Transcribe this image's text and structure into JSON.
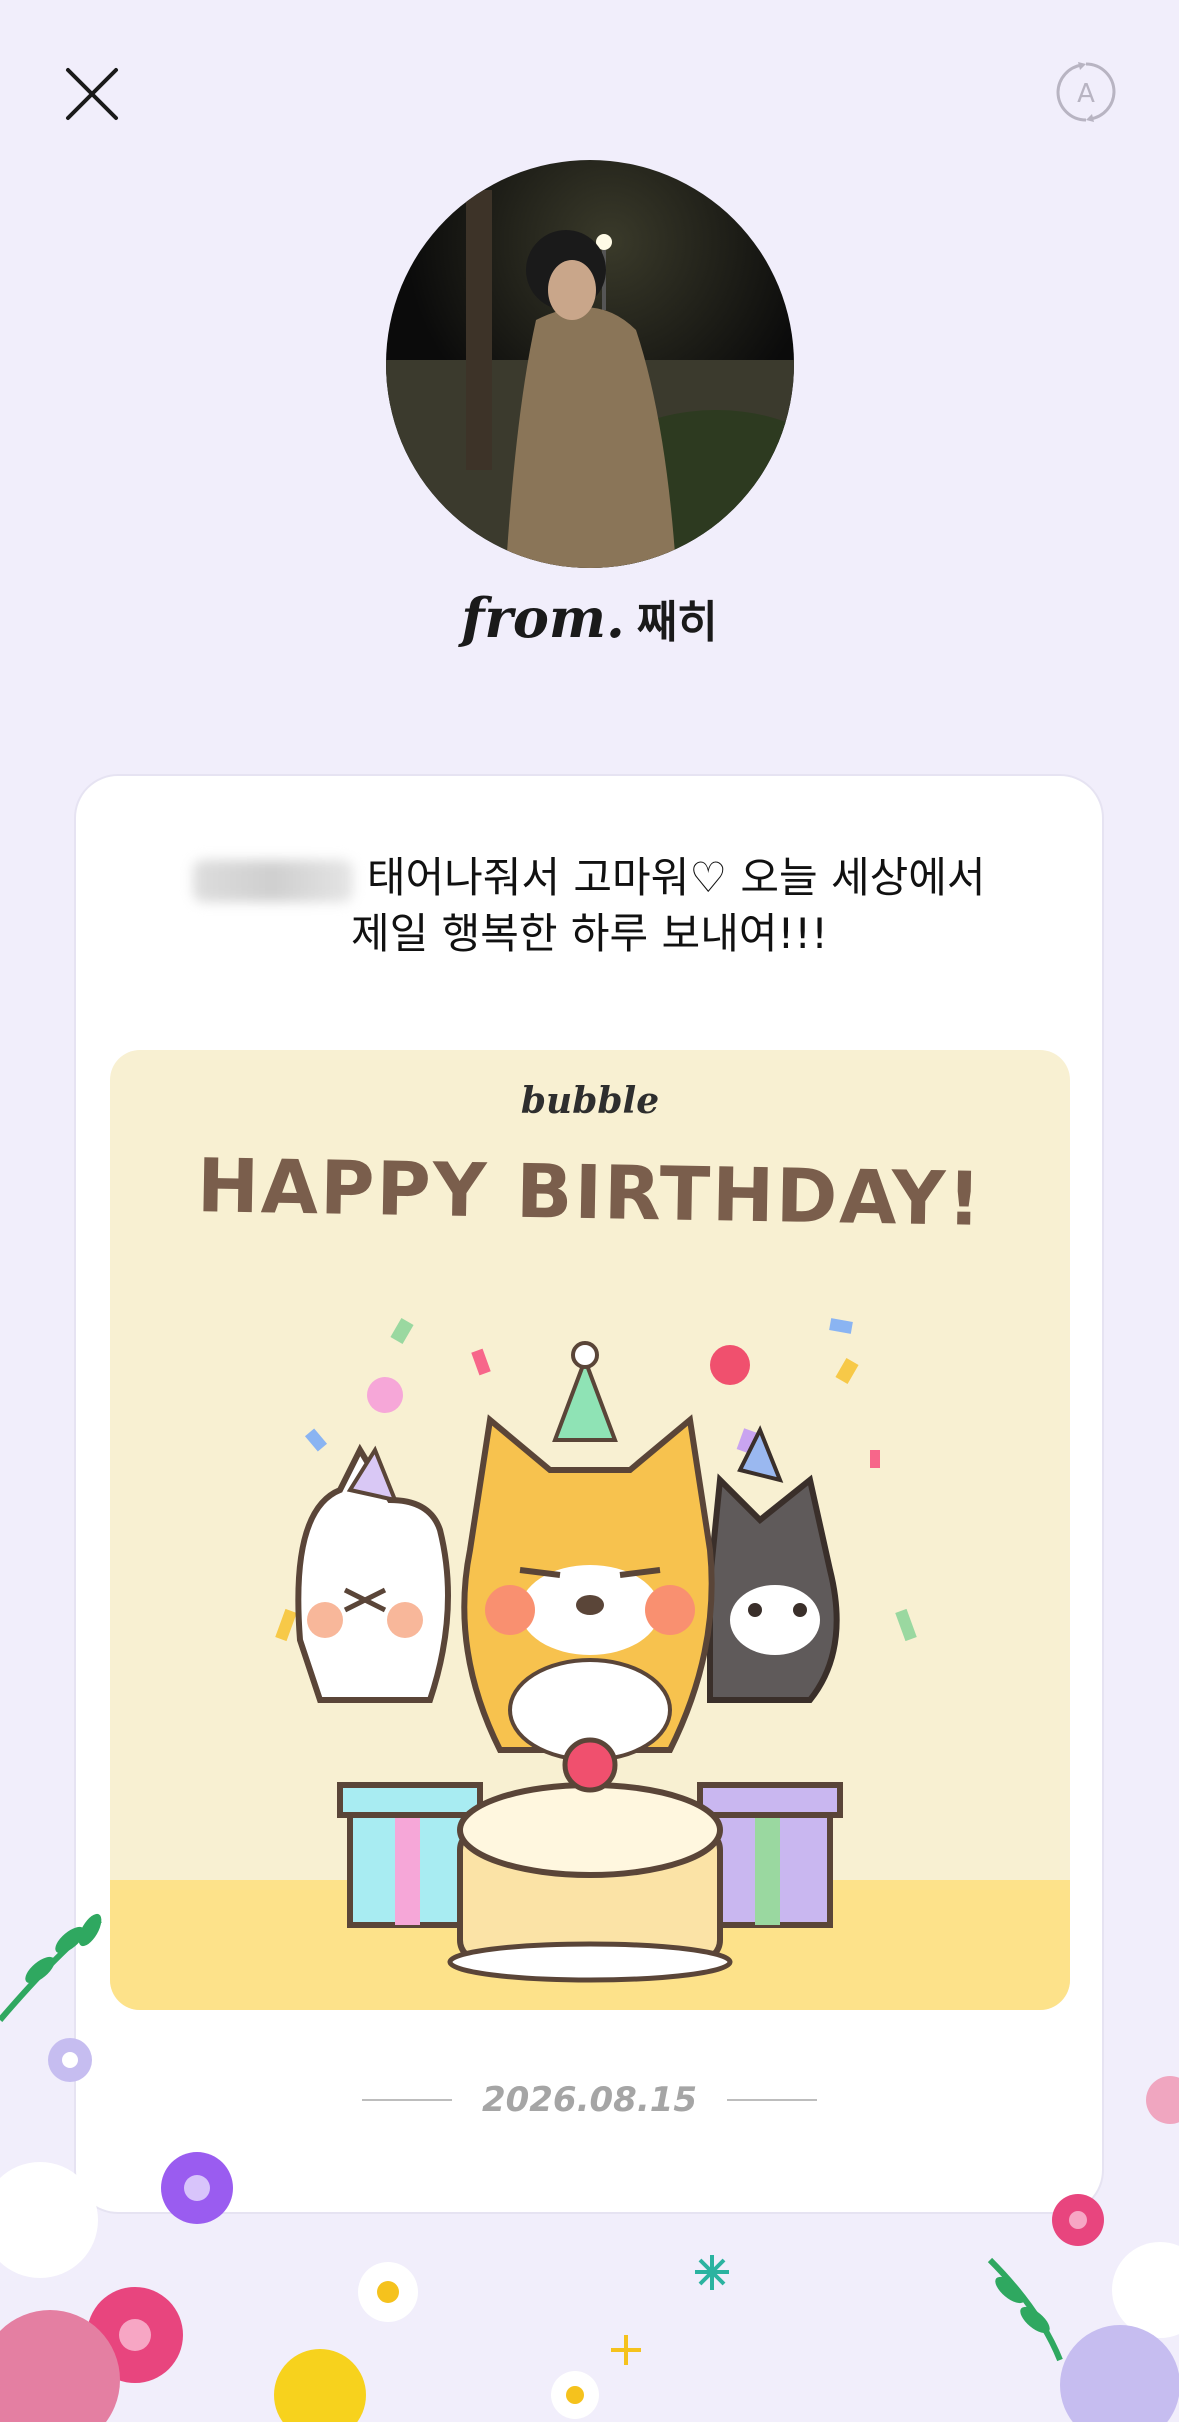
{
  "header": {
    "close_icon": "close-icon",
    "translate_icon": "translate-icon"
  },
  "sender": {
    "from_label": "from.",
    "name": "째히"
  },
  "message": {
    "line1_tail": "태어나줘서 고마워♡ 오늘 세상에서",
    "line2": "제일 행복한 하루 보내여!!!"
  },
  "card_image": {
    "brand": "bubble",
    "title": "HAPPY BIRTHDAY!"
  },
  "date": "2026.08.15",
  "colors": {
    "background": "#f1eefb",
    "card": "#ffffff",
    "card_image_bg": "#f8f0d2",
    "title": "#7a5e4c"
  }
}
